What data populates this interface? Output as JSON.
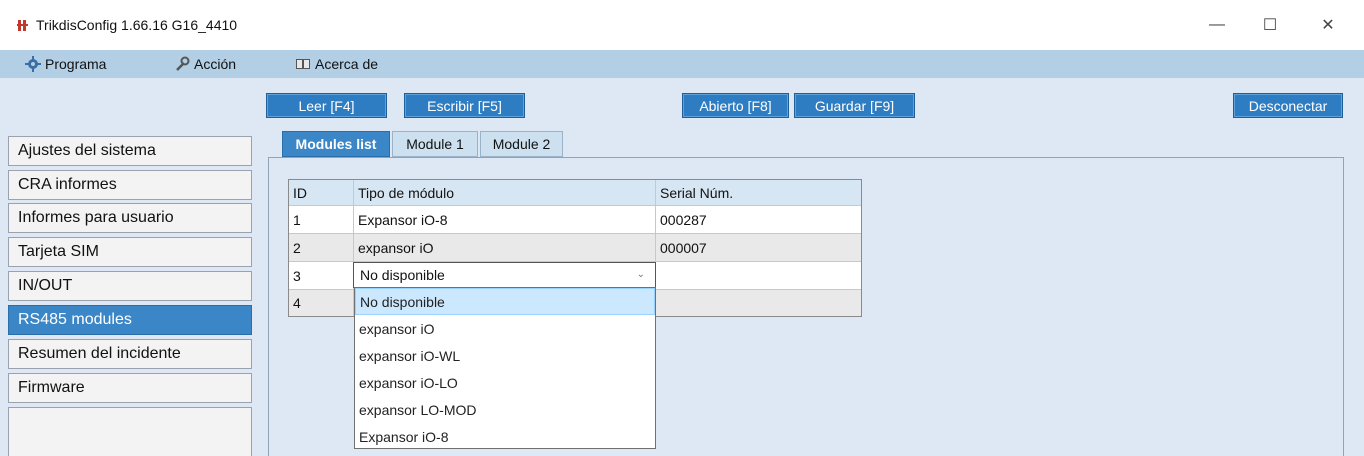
{
  "window": {
    "title": "TrikdisConfig 1.66.16   G16_4410",
    "minimize": "—",
    "maximize": "☐",
    "close": "✕"
  },
  "menu": {
    "programa": "Programa",
    "accion": "Acción",
    "acerca": "Acerca de"
  },
  "toolbar": {
    "leer": "Leer [F4]",
    "escribir": "Escribir [F5]",
    "abierto": "Abierto [F8]",
    "guardar": "Guardar [F9]",
    "desconectar": "Desconectar"
  },
  "sidebar": {
    "items": [
      {
        "label": "Ajustes del sistema"
      },
      {
        "label": "CRA informes"
      },
      {
        "label": "Informes para usuario"
      },
      {
        "label": "Tarjeta SIM"
      },
      {
        "label": "IN/OUT"
      },
      {
        "label": "RS485 modules",
        "active": true
      },
      {
        "label": "Resumen del incidente"
      },
      {
        "label": "Firmware"
      }
    ]
  },
  "tabs": [
    {
      "label": "Modules list",
      "active": true
    },
    {
      "label": "Module 1"
    },
    {
      "label": "Module 2"
    }
  ],
  "grid": {
    "headers": {
      "id": "ID",
      "type": "Tipo de módulo",
      "serial": "Serial Núm."
    },
    "rows": [
      {
        "id": "1",
        "type": "Expansor iO-8",
        "serial": "000287"
      },
      {
        "id": "2",
        "type": "expansor iO",
        "serial": "000007"
      },
      {
        "id": "3",
        "type": "",
        "serial": ""
      },
      {
        "id": "4",
        "type": "",
        "serial": ""
      }
    ]
  },
  "combo": {
    "value": "No disponible",
    "arrow": "⌄",
    "options": [
      {
        "label": "No disponible",
        "selected": true
      },
      {
        "label": "expansor iO"
      },
      {
        "label": "expansor iO-WL"
      },
      {
        "label": "expansor iO-LO"
      },
      {
        "label": "expansor LO-MOD"
      },
      {
        "label": "Expansor iO-8"
      }
    ]
  }
}
